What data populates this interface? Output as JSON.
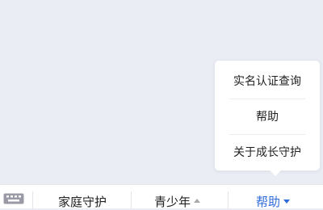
{
  "popup_menu": {
    "items": [
      {
        "label": "实名认证查询"
      },
      {
        "label": "帮助"
      },
      {
        "label": "关于成长守护"
      }
    ]
  },
  "bottom_bar": {
    "keyboard_icon": "keyboard-icon",
    "items": [
      {
        "label": "家庭守护"
      },
      {
        "label": "青少年",
        "icon": "caret-up-icon"
      },
      {
        "label": "帮助",
        "icon": "caret-down-icon",
        "active": true
      }
    ]
  },
  "colors": {
    "accent": "#2f6bd8",
    "background": "#ebedf5"
  }
}
